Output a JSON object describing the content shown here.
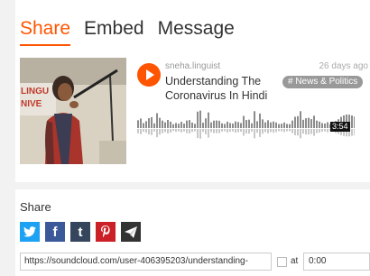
{
  "tabs": [
    {
      "label": "Share",
      "active": true
    },
    {
      "label": "Embed",
      "active": false
    },
    {
      "label": "Message",
      "active": false
    }
  ],
  "player": {
    "username": "sneha.linguist",
    "title": "Understanding The Coronavirus In Hindi",
    "time_ago": "26 days ago",
    "tag": "# News & Politics",
    "duration": "3:54"
  },
  "artwork": {
    "banner_text_1": "LINGU",
    "banner_text_2": "NIVE"
  },
  "share": {
    "heading": "Share",
    "social": [
      {
        "icon": "twitter-icon",
        "color": "#1da1f2",
        "glyph": "🐦"
      },
      {
        "icon": "facebook-icon",
        "color": "#3b5998",
        "glyph": "f"
      },
      {
        "icon": "tumblr-icon",
        "color": "#35465c",
        "glyph": "t"
      },
      {
        "icon": "pinterest-icon",
        "color": "#cb2027",
        "glyph": "P"
      },
      {
        "icon": "email-icon",
        "color": "#333333",
        "glyph": "➤"
      }
    ],
    "url": "https://soundcloud.com/user-406395203/understanding-",
    "at_label": "at",
    "time_value": "0:00"
  },
  "colors": {
    "accent": "#ff5500",
    "tag_bg": "#999999"
  }
}
